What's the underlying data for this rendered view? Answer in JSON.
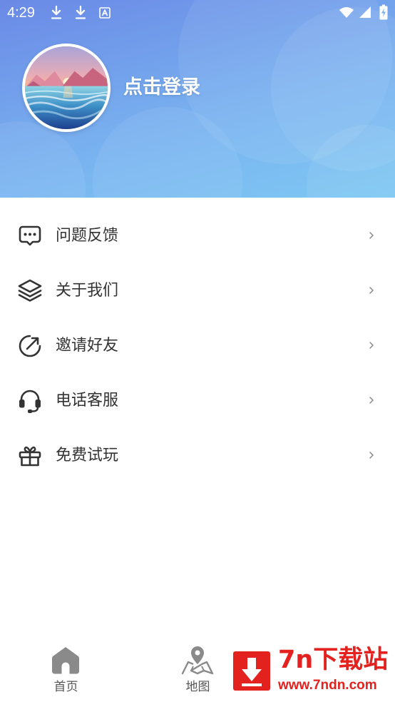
{
  "status_bar": {
    "time": "4:29",
    "icons": [
      "download-icon",
      "download-icon",
      "a-badge-icon",
      "wifi-icon",
      "signal-icon",
      "battery-icon"
    ]
  },
  "profile": {
    "login_label": "点击登录",
    "avatar": "landscape-avatar"
  },
  "menu": {
    "items": [
      {
        "label": "问题反馈",
        "icon": "feedback-icon"
      },
      {
        "label": "关于我们",
        "icon": "layers-icon"
      },
      {
        "label": "邀请好友",
        "icon": "share-arrow-icon"
      },
      {
        "label": "电话客服",
        "icon": "headset-icon"
      },
      {
        "label": "免费试玩",
        "icon": "gift-icon"
      }
    ]
  },
  "bottom_nav": {
    "items": [
      {
        "label": "首页",
        "icon": "home-icon"
      },
      {
        "label": "地图",
        "icon": "map-icon"
      }
    ]
  },
  "watermark": {
    "brand": "7n下载站",
    "url": "www.7ndn.com"
  },
  "theme": {
    "header_top": "#6a89e6",
    "header_mid": "#78b0ef",
    "header_bottom": "#7ec8f3",
    "text": "#333333",
    "muted": "#8a8a8a",
    "watermark_red": "#e3211f"
  }
}
